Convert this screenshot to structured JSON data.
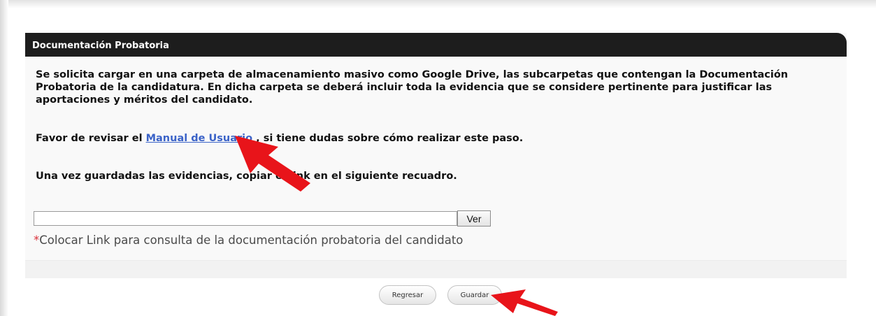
{
  "panel": {
    "title": "Documentación Probatoria",
    "paragraph1": "Se solicita cargar en una carpeta de almacenamiento masivo como Google Drive, las subcarpetas que contengan la Documentación Probatoria de la candidatura. En dicha carpeta se deberá incluir toda la evidencia que se considere pertinente para justificar las aportaciones y méritos del candidato.",
    "paragraph2_before": "Favor de revisar el ",
    "manual_link": "Manual de Usuario",
    "paragraph2_after": " , si tiene dudas sobre cómo realizar este paso.",
    "paragraph3": "Una vez guardadas las evidencias, copiar el link en el siguiente recuadro."
  },
  "link_field": {
    "value": "",
    "placeholder": ""
  },
  "ver_button": "Ver",
  "note": {
    "asterisk": "*",
    "text": "Colocar Link para consulta de la documentación probatoria del candidato"
  },
  "actions": {
    "back_label": "Regresar",
    "save_label": "Guardar"
  },
  "colors": {
    "header_bg": "#1d1d1d",
    "link": "#3b63c8",
    "asterisk": "#d9303a",
    "annotation_arrow": "#e8141a"
  },
  "annotation_icons": [
    "red-arrow-icon",
    "red-arrow-icon"
  ]
}
